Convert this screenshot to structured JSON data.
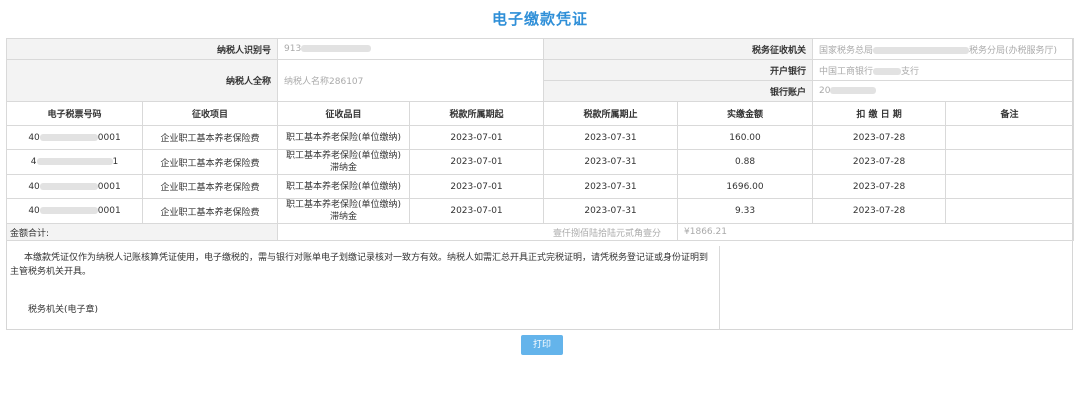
{
  "title": "电子缴款凭证",
  "taxpayer": {
    "id_label": "纳税人识别号",
    "id_value": "913",
    "name_label": "纳税人全称",
    "name_value": "纳税人名称286107"
  },
  "tax_authority": {
    "label": "税务征收机关",
    "value_prefix": "国家税务总局",
    "value_suffix": "税务分局(办税服务厅)"
  },
  "bank": {
    "label": "开户银行",
    "value_prefix": "中国工商银行",
    "value_suffix": "支行",
    "account_label": "银行账户",
    "account_value": "20"
  },
  "table": {
    "headers": [
      "电子税票号码",
      "征收项目",
      "征收品目",
      "税款所属期起",
      "税款所属期止",
      "实缴金额",
      "扣 缴 日 期",
      "备注"
    ],
    "rows": [
      {
        "ticket_prefix": "40",
        "ticket_suffix": "0001",
        "project": "企业职工基本养老保险费",
        "item": "职工基本养老保险(单位缴纳)",
        "from": "2023-07-01",
        "to": "2023-07-31",
        "amount": "160.00",
        "date": "2023-07-28",
        "note": ""
      },
      {
        "ticket_prefix": "4",
        "ticket_suffix": "1",
        "project": "企业职工基本养老保险费",
        "item": "职工基本养老保险(单位缴纳)滞纳金",
        "from": "2023-07-01",
        "to": "2023-07-31",
        "amount": "0.88",
        "date": "2023-07-28",
        "note": ""
      },
      {
        "ticket_prefix": "40",
        "ticket_suffix": "0001",
        "project": "企业职工基本养老保险费",
        "item": "职工基本养老保险(单位缴纳)",
        "from": "2023-07-01",
        "to": "2023-07-31",
        "amount": "1696.00",
        "date": "2023-07-28",
        "note": ""
      },
      {
        "ticket_prefix": "40",
        "ticket_suffix": "0001",
        "project": "企业职工基本养老保险费",
        "item": "职工基本养老保险(单位缴纳)滞纳金",
        "from": "2023-07-01",
        "to": "2023-07-31",
        "amount": "9.33",
        "date": "2023-07-28",
        "note": ""
      }
    ]
  },
  "total": {
    "label": "金额合计:",
    "in_words": "壹仟捌佰陆拾陆元贰角壹分",
    "value": "¥1866.21"
  },
  "notes": {
    "text": "本缴款凭证仅作为纳税人记账核算凭证使用，电子缴税的，需与银行对账单电子划缴记录核对一致方有效。纳税人如需汇总开具正式完税证明，请凭税务登记证或身份证明到主管税务机关开具。",
    "seal": "税务机关(电子章)"
  },
  "print_button": "打印"
}
